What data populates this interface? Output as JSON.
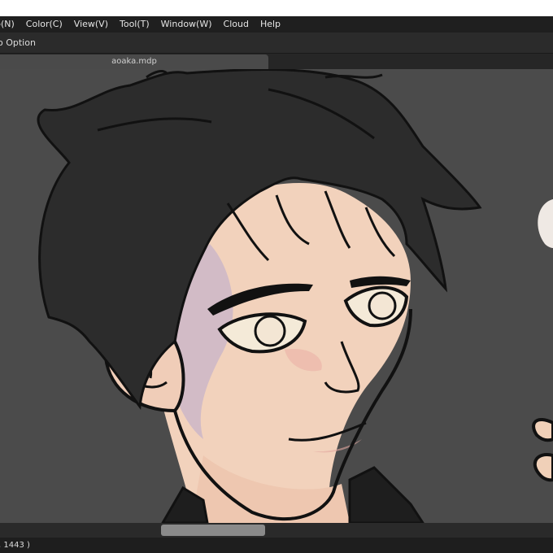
{
  "menu": [
    "p(N)",
    "Color(C)",
    "View(V)",
    "Tool(T)",
    "Window(W)",
    "Cloud",
    "Help"
  ],
  "option_bar": {
    "label": "o Option"
  },
  "tabs": [
    {
      "label": "aoaka.mdp"
    }
  ],
  "status": {
    "coords": ", 1443 )"
  },
  "colors": {
    "menubar": "#1f1f1f",
    "canvas": "#4b4b4b",
    "skin": "#f2d2bc",
    "hair": "#2c2c2c"
  },
  "icons": [
    "scrollbar-thumb"
  ]
}
